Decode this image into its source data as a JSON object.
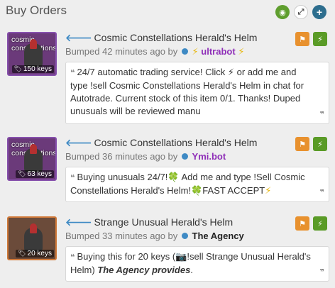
{
  "header": {
    "title": "Buy Orders",
    "buttons": {
      "eye": "◉",
      "expand": "⤢",
      "add": "+"
    }
  },
  "orders": [
    {
      "effect_label": "cosmic constellations",
      "price": "150 keys",
      "item_name": "Cosmic Constellations Herald's Helm",
      "bumped": "Bumped 42 minutes ago by",
      "user": "ultrabot",
      "message": "24/7 automatic trading service! Click ⚡ or add me and type !sell Cosmic Constellations Herald's Helm in chat for Autotrade. Current stock of this item 0/1. Thanks! Duped unusuals will be reviewed manu"
    },
    {
      "effect_label": "cosmic constellations",
      "price": "63 keys",
      "item_name": "Cosmic Constellations Herald's Helm",
      "bumped": "Bumped 36 minutes ago by",
      "user": "Ymi.bot",
      "message_a": "Buying unusuals 24/7!",
      "message_b": " Add me and type !Sell Cosmic Constellations Herald's Helm!",
      "message_c": "FAST ACCEPT",
      "clover": "🍀"
    },
    {
      "price": "20 keys",
      "item_name": "Strange Unusual Herald's Helm",
      "bumped": "Bumped 33 minutes ago by",
      "user": "The Agency",
      "message_a": "Buying this for 20 keys (📷!sell Strange Unusual Herald's Helm)",
      "message_b": "The Agency provides",
      "message_c": "."
    }
  ],
  "icons": {
    "back_arrow": "🡐",
    "flag": "⚑",
    "bolt": "⚡",
    "tag": "🏷",
    "quote_open": "❝",
    "quote_close": "❞"
  },
  "colors": {
    "flag": "#e8912e",
    "bolt": "#5a9b27",
    "link_blue": "#3e8ac4",
    "ultrabot": "#8f2fb8"
  }
}
